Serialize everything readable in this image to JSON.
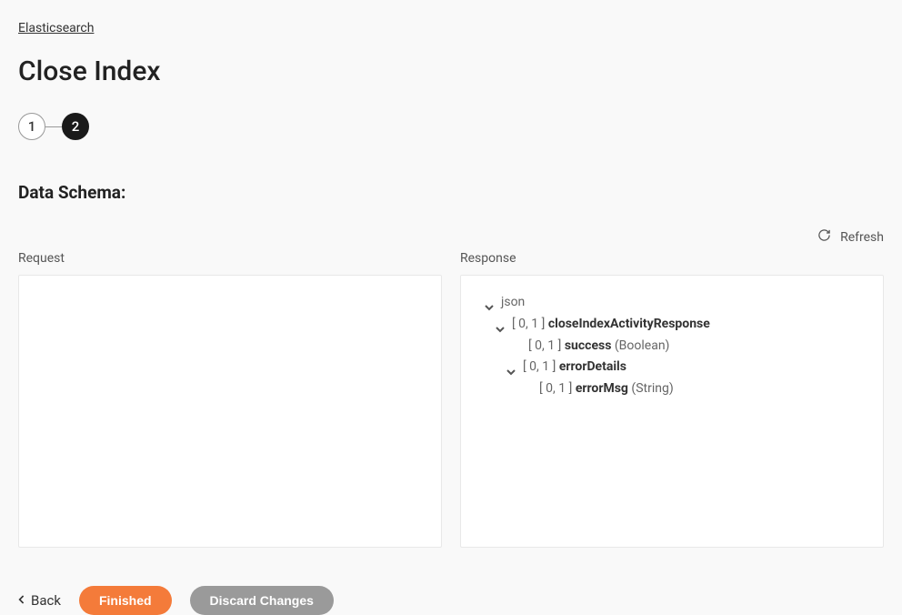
{
  "breadcrumb": {
    "label": "Elasticsearch"
  },
  "page": {
    "title": "Close Index"
  },
  "stepper": {
    "step1": "1",
    "step2": "2"
  },
  "section": {
    "title": "Data Schema:"
  },
  "refresh": {
    "label": "Refresh"
  },
  "request": {
    "label": "Request"
  },
  "response": {
    "label": "Response",
    "tree": {
      "root": "json",
      "l1_cardinality": "[ 0, 1 ]",
      "l1_name": "closeIndexActivityResponse",
      "l2a_cardinality": "[ 0, 1 ]",
      "l2a_name": "success",
      "l2a_type": "(Boolean)",
      "l2b_cardinality": "[ 0, 1 ]",
      "l2b_name": "errorDetails",
      "l3_cardinality": "[ 0, 1 ]",
      "l3_name": "errorMsg",
      "l3_type": "(String)"
    }
  },
  "footer": {
    "back": "Back",
    "finished": "Finished",
    "discard": "Discard Changes"
  }
}
